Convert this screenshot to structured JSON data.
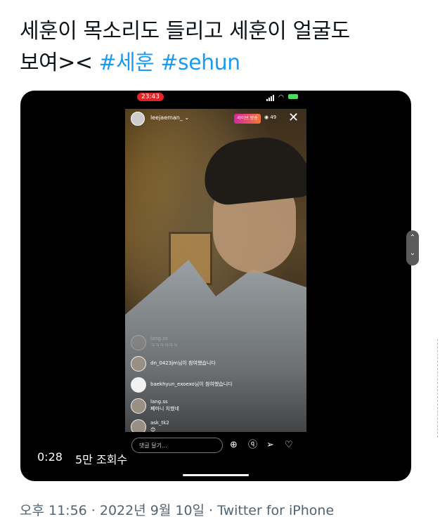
{
  "tweet": {
    "text_line1": "세훈이 목소리도 들리고 세훈이 얼굴도",
    "text_line2_plain": "보여><",
    "hashtag1": "#세훈",
    "hashtag2": "#sehun"
  },
  "video": {
    "status_time": "23:43",
    "elapsed": "0:28",
    "views": "5만 조회수",
    "live": {
      "username": "leejaeman_",
      "live_badge": "라이브 방송",
      "viewer_count": "49",
      "comment_placeholder": "댓글 달기...",
      "comments": [
        {
          "user": "lang.ss",
          "text": "ㅋㅋㅋㅋㅋㅋ",
          "faded": true
        },
        {
          "user": "",
          "text": "dn_0423jm님이 참여했습니다",
          "faded": false
        },
        {
          "user": "",
          "text": "baekhyun_exoexo님이 참여했습니다",
          "faded": false
        },
        {
          "user": "lang.ss",
          "text": "쩨마니 치했네",
          "faded": false
        },
        {
          "user": "ask_tk2",
          "text": "😊",
          "faded": false
        }
      ]
    }
  },
  "meta": {
    "line": "오후 11:56 · 2022년 9월 10일 · Twitter for iPhone"
  },
  "icons": [
    "close-icon",
    "eye-icon",
    "plus-icon",
    "question-icon",
    "send-icon",
    "heart-icon",
    "chevron-up-icon",
    "chevron-down-icon",
    "wifi-icon",
    "battery-icon",
    "signal-icon"
  ]
}
